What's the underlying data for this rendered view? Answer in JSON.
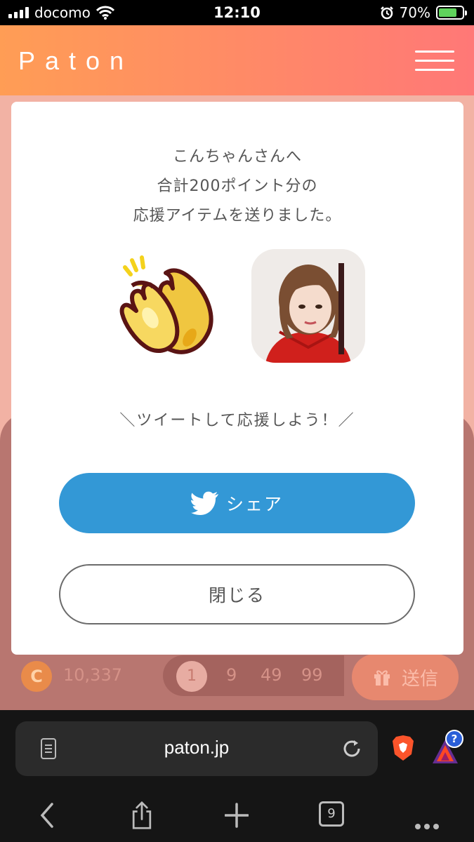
{
  "status_bar": {
    "carrier": "docomo",
    "time": "12:10",
    "battery": "70%",
    "battery_level": 0.7
  },
  "header": {
    "logo": "Paton",
    "menu_icon": "hamburger-menu-icon"
  },
  "modal": {
    "message_lines": [
      "こんちゃんさんへ",
      "合計200ポイント分の",
      "応援アイテムを送りました。"
    ],
    "item_icon": "clapping-hands-icon",
    "tweet_prompt": "＼ツイートして応援しよう！／",
    "share_label": "シェア",
    "share_icon": "twitter-bird-icon",
    "close_label": "閉じる",
    "colors": {
      "share": "#3398d6"
    }
  },
  "footer": {
    "coin_symbol": "C",
    "coin_count": "10,337",
    "point_options": [
      "1",
      "9",
      "49",
      "99"
    ],
    "selected_point": "1",
    "send_label": "送信",
    "send_icon": "gift-icon"
  },
  "browser": {
    "url": "paton.jp",
    "tab_count": "9",
    "help_badge": "?"
  }
}
